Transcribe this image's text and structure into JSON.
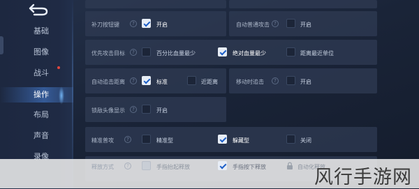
{
  "sidebar": {
    "items": [
      {
        "label": "基础",
        "active": false
      },
      {
        "label": "图像",
        "active": false
      },
      {
        "label": "战斗",
        "active": false,
        "badge": true
      },
      {
        "label": "操作",
        "active": true
      },
      {
        "label": "布局",
        "active": false
      },
      {
        "label": "声音",
        "active": false
      },
      {
        "label": "录像",
        "active": false
      }
    ]
  },
  "settings": {
    "row1": {
      "left_label": "补刀按钮键",
      "left_option": "开启",
      "right_label": "自动普通攻击",
      "right_option": "开启"
    },
    "row2": {
      "label": "优先攻击目标",
      "options": [
        "百分比血量最少",
        "绝对血量最少",
        "距离最近单位"
      ]
    },
    "row3": {
      "left_label": "自动追击距离",
      "left_options": [
        "标准",
        "近距离"
      ],
      "right_label": "移动时追击",
      "right_option": "开启"
    },
    "row4": {
      "label": "锁敌头像显示",
      "option": "开启"
    },
    "row5": {
      "label": "精准普攻",
      "options": [
        "精准型",
        "躲藏型",
        "关闭"
      ]
    },
    "row6": {
      "label": "释放方式",
      "options": [
        "手指抬起释放",
        "手指按下释放",
        "自动化释放"
      ]
    }
  },
  "colors": {
    "accent": "#1e60c8",
    "checkbox_on": "#e7edf6",
    "badge": "#e0463e"
  },
  "watermark": "风行手游网"
}
